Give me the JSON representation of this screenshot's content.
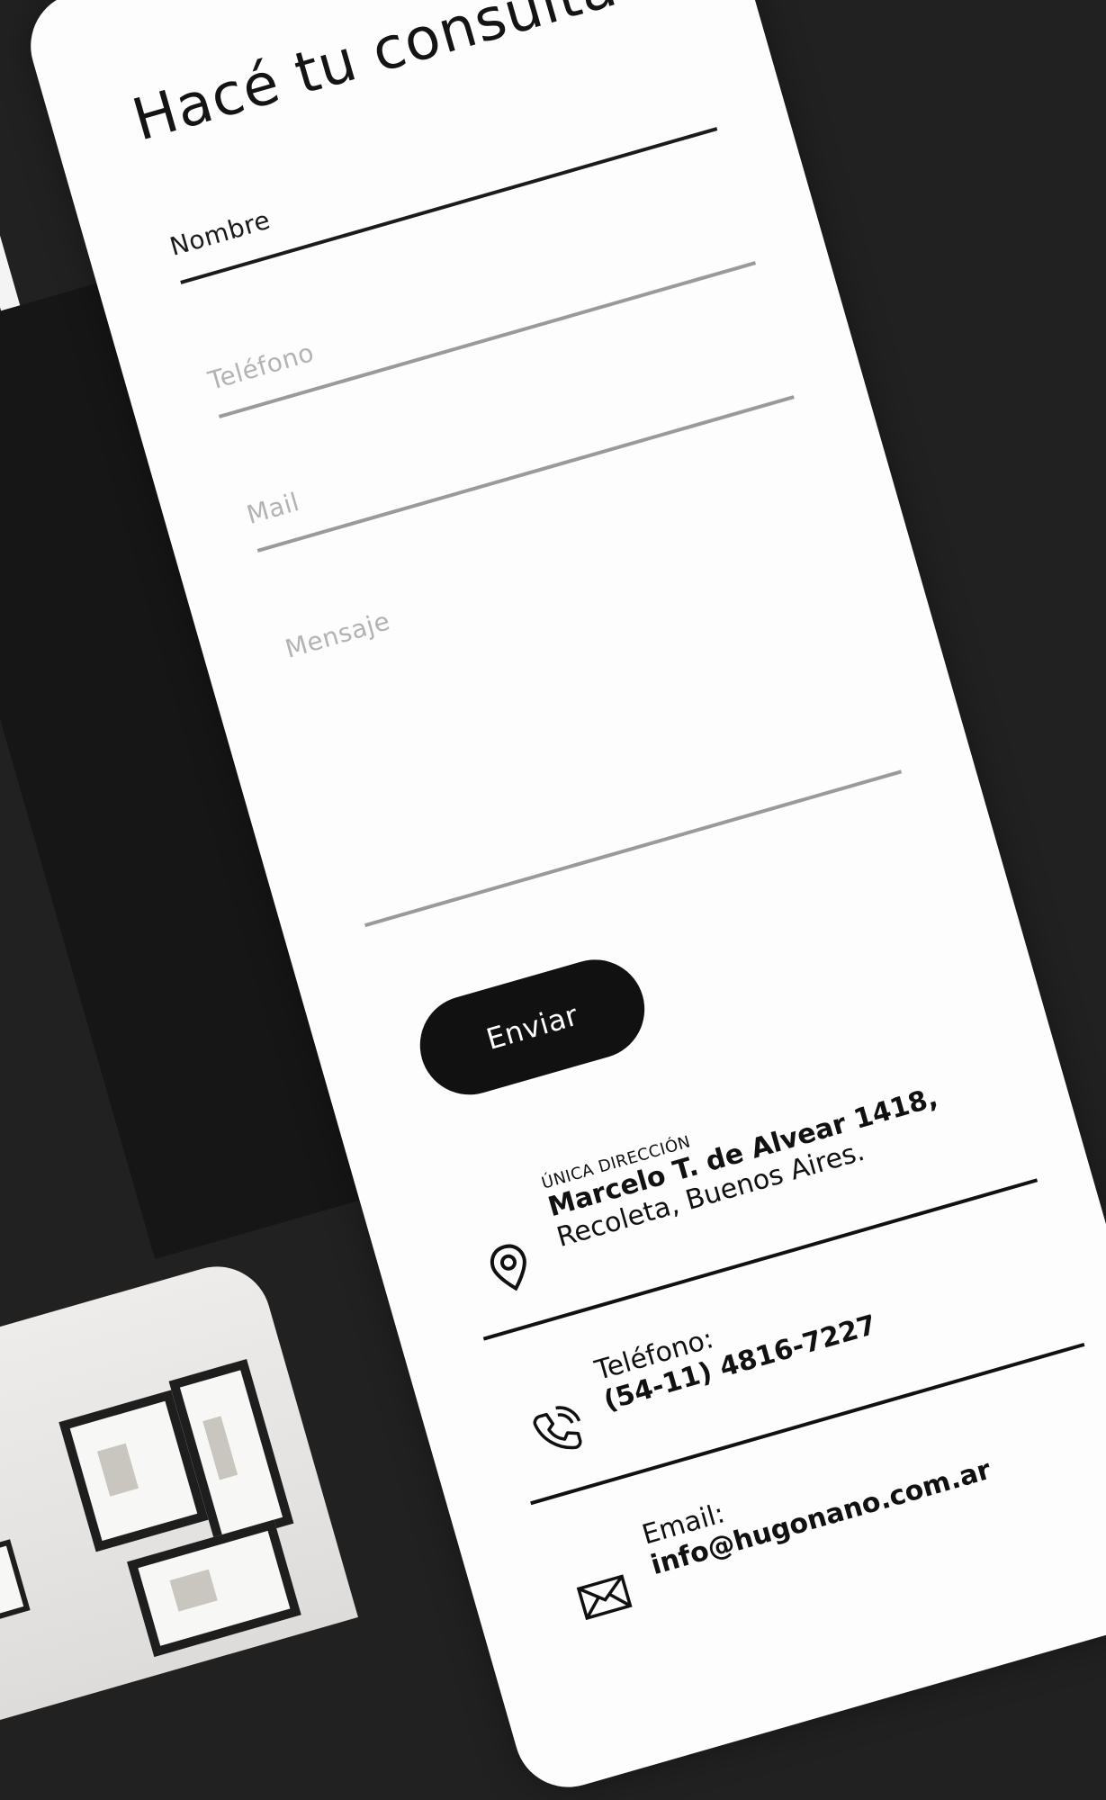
{
  "form": {
    "title": "Hacé tu consulta",
    "fields": {
      "nombre": "Nombre",
      "telefono": "Teléfono",
      "mail": "Mail",
      "mensaje": "Mensaje"
    },
    "submit_label": "Enviar"
  },
  "contact": {
    "address": {
      "label": "ÚNICA DIRECCIÓN",
      "line1": "Marcelo T. de Alvear 1418,",
      "line2": "Recoleta, Buenos Aires."
    },
    "phone": {
      "label": "Teléfono:",
      "value": "(54-11) 4816-7227"
    },
    "email": {
      "label": "Email:",
      "value": "info@hugonano.com.ar"
    }
  }
}
